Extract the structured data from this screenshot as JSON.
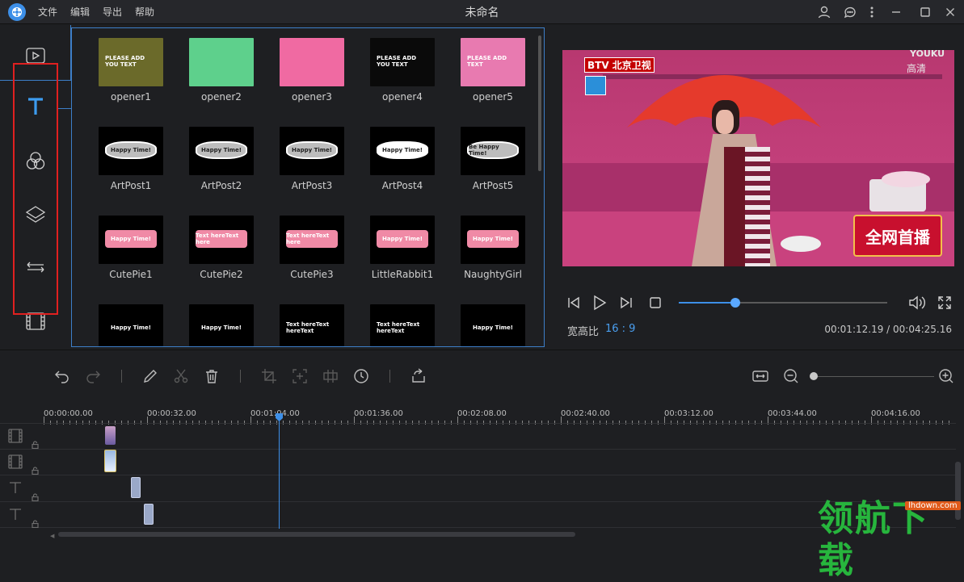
{
  "titlebar": {
    "title": "未命名",
    "menu": [
      "文件",
      "编辑",
      "导出",
      "帮助"
    ]
  },
  "sidebar": {
    "items": [
      "media-icon",
      "text-icon",
      "filter-icon",
      "overlay-icon",
      "transition-icon",
      "film-icon"
    ]
  },
  "templates": [
    {
      "label": "opener1",
      "thumb": "PLEASE ADD YOU TEXT",
      "bg": "#6b6a2a"
    },
    {
      "label": "opener2",
      "thumb": "",
      "bg": "#5ed08c"
    },
    {
      "label": "opener3",
      "thumb": "",
      "bg": "#f06aa2"
    },
    {
      "label": "opener4",
      "thumb": "PLEASE ADD YOU TEXT",
      "bg": "#0a0a0a"
    },
    {
      "label": "opener5",
      "thumb": "PLEASE ADD TEXT",
      "bg": "#e87ab0"
    },
    {
      "label": "ArtPost1",
      "thumb": "Happy Time!",
      "bg": "#000"
    },
    {
      "label": "ArtPost2",
      "thumb": "Happy Time!",
      "bg": "#000"
    },
    {
      "label": "ArtPost3",
      "thumb": "Happy Time!",
      "bg": "#000"
    },
    {
      "label": "ArtPost4",
      "thumb": "Happy Time!",
      "bg": "#000"
    },
    {
      "label": "ArtPost5",
      "thumb": "Be Happy Time!",
      "bg": "#000"
    },
    {
      "label": "CutePie1",
      "thumb": "Happy Time!",
      "bg": "#000"
    },
    {
      "label": "CutePie2",
      "thumb": "Text hereText here",
      "bg": "#000"
    },
    {
      "label": "CutePie3",
      "thumb": "Text hereText here",
      "bg": "#000"
    },
    {
      "label": "LittleRabbit1",
      "thumb": "Happy Time!",
      "bg": "#000"
    },
    {
      "label": "NaughtyGirl",
      "thumb": "Happy Time!",
      "bg": "#000"
    },
    {
      "label": "",
      "thumb": "Happy Time!",
      "bg": "#000"
    },
    {
      "label": "",
      "thumb": "Happy Time!",
      "bg": "#000"
    },
    {
      "label": "",
      "thumb": "Text hereText hereText",
      "bg": "#000"
    },
    {
      "label": "",
      "thumb": "Text hereText hereText",
      "bg": "#000"
    },
    {
      "label": "",
      "thumb": "Happy Time!",
      "bg": "#000"
    }
  ],
  "preview": {
    "channel": "BTV 北京卫视",
    "quality": "高清",
    "watermark": "YOUKU",
    "banner": "全网首播",
    "aspect_label": "宽高比",
    "aspect_value": "16 : 9",
    "timecode": "00:01:12.19 / 00:04:25.16",
    "progress": 0.27
  },
  "timeline": {
    "ticks": [
      "00:00:00.00",
      "00:00:32.00",
      "00:01:04.00",
      "00:01:36.00",
      "00:02:08.00",
      "00:02:40.00",
      "00:03:12.00",
      "00:03:44.00",
      "00:04:16.00"
    ],
    "zoom": 0.0
  },
  "watermark": {
    "text": "领航下载",
    "url": "lhdown.com"
  }
}
